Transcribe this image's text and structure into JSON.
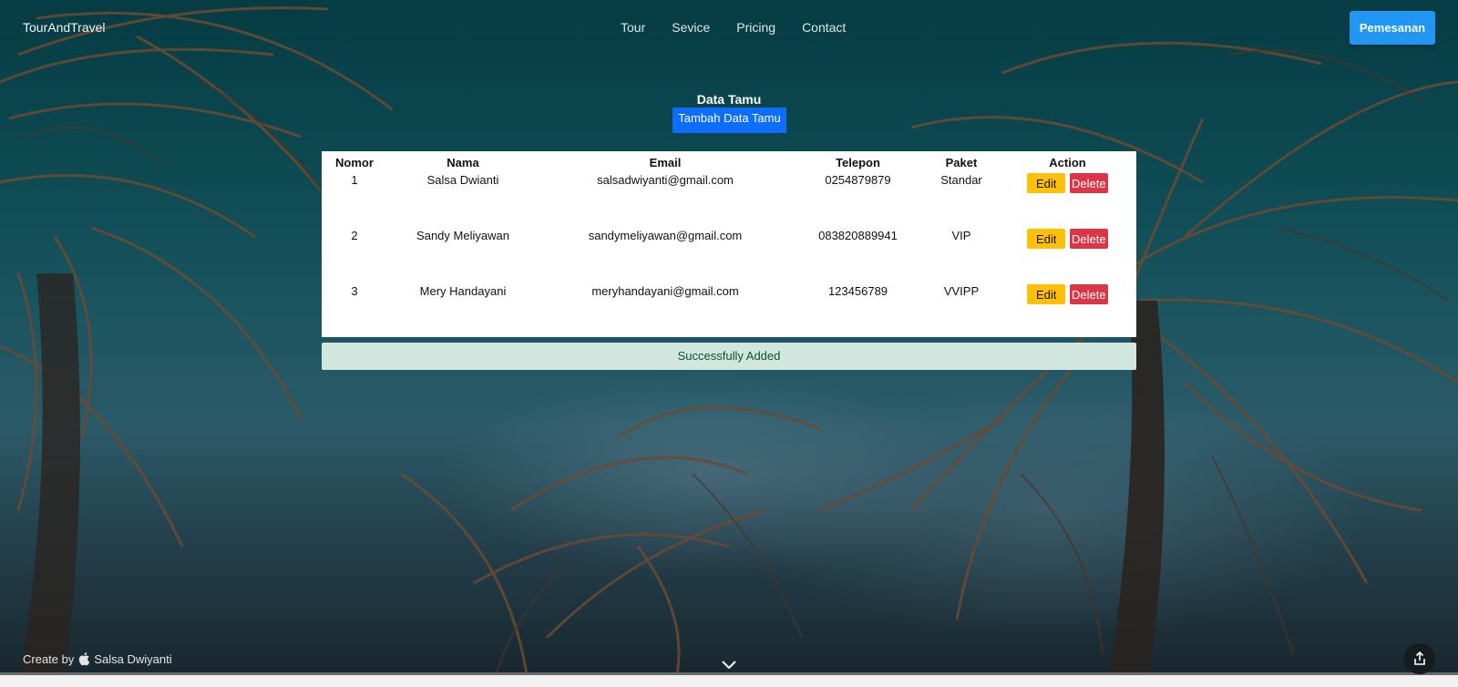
{
  "nav": {
    "brand": "TourAndTravel",
    "links": [
      "Tour",
      "Sevice",
      "Pricing",
      "Contact"
    ],
    "order_button": "Pemesanan"
  },
  "main": {
    "title": "Data Tamu",
    "add_button": "Tambah Data Tamu",
    "table": {
      "headers": [
        "Nomor",
        "Nama",
        "Email",
        "Telepon",
        "Paket",
        "Action"
      ],
      "rows": [
        {
          "nomor": "1",
          "nama": "Salsa Dwianti",
          "email": "salsadwiyanti@gmail.com",
          "telepon": "0254879879",
          "paket": "Standar",
          "edit": "Edit",
          "delete": "Delete"
        },
        {
          "nomor": "2",
          "nama": "Sandy Meliyawan",
          "email": "sandymeliyawan@gmail.com",
          "telepon": "083820889941",
          "paket": "VIP",
          "edit": "Edit",
          "delete": "Delete"
        },
        {
          "nomor": "3",
          "nama": "Mery Handayani",
          "email": "meryhandayani@gmail.com",
          "telepon": "123456789",
          "paket": "VVIPP",
          "edit": "Edit",
          "delete": "Delete"
        }
      ]
    },
    "alert": "Successfully Added"
  },
  "footer": {
    "credit_prefix": "Create by",
    "credit_name": "Salsa Dwiyanti"
  },
  "colors": {
    "primary": "#0d6efd",
    "order_button": "#2196f3",
    "edit": "#ffc107",
    "delete": "#dc3545",
    "alert_bg": "#d1e7dd"
  },
  "icons": {
    "credit": "apple-icon",
    "scroll": "chevron-down-icon",
    "share": "share-icon"
  }
}
